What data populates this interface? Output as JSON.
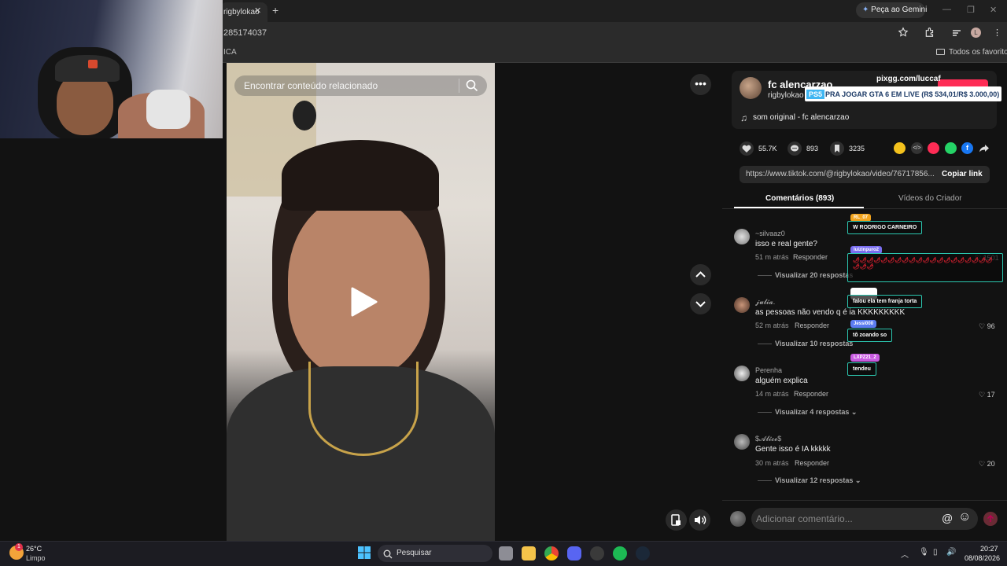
{
  "browser": {
    "tab_title": "rigbylokao",
    "tab_close": "✕",
    "new_tab": "+",
    "gemini_button": "Peça ao Gemini",
    "url_fragment": "285174037",
    "bookmark_fragment": "ICA",
    "bookmarks_folder": "Todos os favoritos",
    "window_controls": [
      "—",
      "❐",
      "✕"
    ]
  },
  "video": {
    "search_placeholder": "Encontrar conteúdo relacionado",
    "more_icon": "•••"
  },
  "creator": {
    "name": "fc alencarzao",
    "handle": "rigbylokao",
    "music": "som original - fc alencarzao",
    "music_note": "♫"
  },
  "stream_overlay": {
    "pix_label": "pixgg.com/luccaf",
    "donation_tag": "PS5",
    "donation_text": "PRA JOGAR GTA 6 EM LIVE (R$ 534,01/R$ 3.000,00)"
  },
  "stats": {
    "likes": "55.7K",
    "comments": "893",
    "saves": "3235"
  },
  "share": {
    "link": "https://www.tiktok.com/@rigbylokao/video/76717856...",
    "copy_label": "Copiar link"
  },
  "tabs": {
    "comments": "Comentários (893)",
    "videos": "Vídeos do Criador"
  },
  "comments": [
    {
      "user": "~silvaaz0",
      "text": "isso e real gente?",
      "time": "51 m atrás",
      "reply": "Responder",
      "likes": "1501",
      "view": "Visualizar 20 respostas"
    },
    {
      "user": "𝓳𝓾𝓵𝓲𝓪.",
      "text": "as pessoas não vendo q é ia KKKKKKKKK",
      "time": "52 m atrás",
      "reply": "Responder",
      "likes": "96",
      "view": "Visualizar 10 respostas"
    },
    {
      "user": "Perenha",
      "text": "alguém explica",
      "time": "14 m atrás",
      "reply": "Responder",
      "likes": "17",
      "view": "Visualizar 4 respostas"
    },
    {
      "user": "$𝓐𝓵𝓲𝓬𝓮$",
      "text": "Gente isso é IA kkkkk",
      "time": "30 m atrás",
      "reply": "Responder",
      "likes": "20",
      "view": "Visualizar 12 respostas"
    }
  ],
  "chat": [
    {
      "tag": "RL_07",
      "color": "#f2a31c",
      "text": "W RODRIGO CARNEIRO"
    },
    {
      "tag": "luizinpuro2",
      "color": "#7a6ef0",
      "text": "🌶🌶🌶🌶🌶🌶🌶🌶🌶🌶🌶🌶🌶🌶🌶🌶🌶🌶🌶🌶🌶🌶🌶"
    },
    {
      "tag": "",
      "color": "#ffffff",
      "text": "falou ela tem franja torta"
    },
    {
      "tag": "Jessi000",
      "color": "#5b7cf0",
      "text": "tô zoando so"
    },
    {
      "tag": "LXPZ21_2",
      "color": "#c85ae0",
      "text": "tendeu"
    }
  ],
  "composer": {
    "placeholder": "Adicionar comentário...",
    "mention_icon": "@",
    "emoji_icon": "☺"
  },
  "taskbar": {
    "temperature": "26°C",
    "weather": "Limpo",
    "search": "Pesquisar",
    "time": "20:27",
    "date": "08/08/2026",
    "badge": "1"
  }
}
